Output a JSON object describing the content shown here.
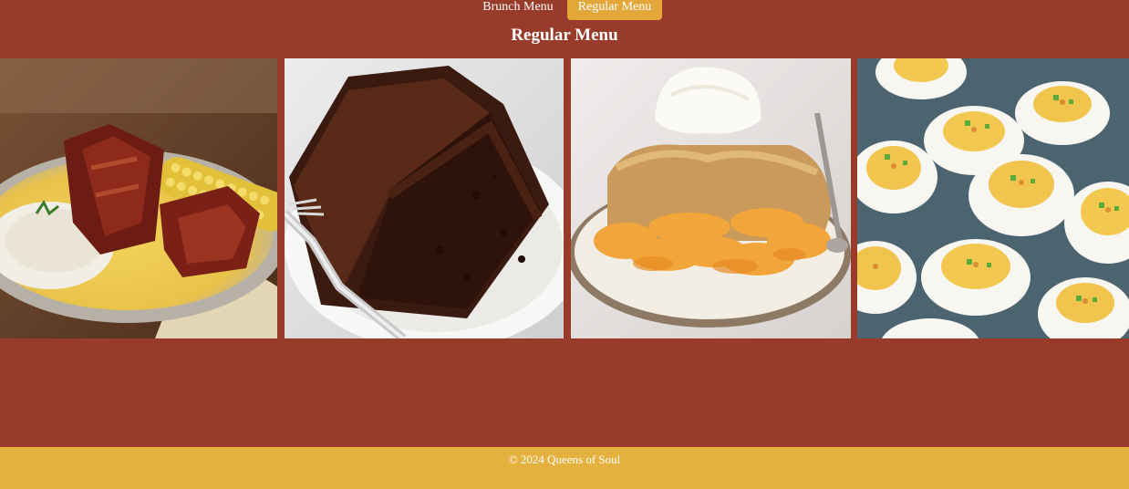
{
  "nav": {
    "tabs": [
      {
        "label": "Brunch Menu",
        "active": false
      },
      {
        "label": "Regular Menu",
        "active": true
      }
    ]
  },
  "page": {
    "title": "Regular Menu"
  },
  "gallery": {
    "items": [
      {
        "icon": "bbq-ribs-plate-photo"
      },
      {
        "icon": "chocolate-cake-slice-photo"
      },
      {
        "icon": "peach-cobbler-photo"
      },
      {
        "icon": "deviled-eggs-photo"
      }
    ]
  },
  "footer": {
    "text": "© 2024 Queens of Soul"
  },
  "colors": {
    "background": "#993b2b",
    "accent": "#e4a83a",
    "footer": "#e4b13e",
    "text": "#ffffff"
  }
}
